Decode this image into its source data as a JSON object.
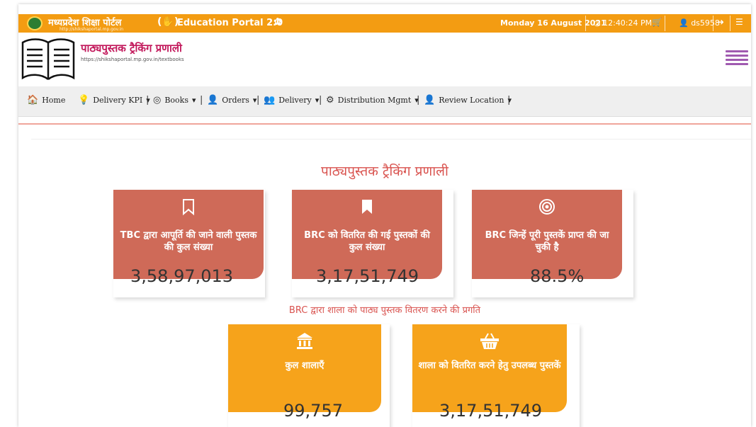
{
  "topbar": {
    "site_name": "मध्यप्रदेश शिक्षा पोर्टल",
    "site_url": "http://shikshaportal.mp.gov.in",
    "portal_name": "Education Portal 2.0",
    "date": "Monday 16 August 2021",
    "time": "12:40:24 PM",
    "user": "ds5958"
  },
  "header": {
    "app_title": "पाठ्यपुस्तक ट्रैकिंग प्रणाली",
    "app_url": "https://shikshaportal.mp.gov.in/textbooks"
  },
  "nav": {
    "home": "Home",
    "delivery_kpi": "Delivery KPI",
    "books": "Books",
    "orders": "Orders",
    "delivery": "Delivery",
    "distribution": "Distribution Mgmt",
    "review_location": "Review Location",
    "caret": "▾",
    "separator": "|"
  },
  "main": {
    "title": "पाठ्यपुस्तक ट्रैकिंग प्रणाली",
    "section2_title": "BRC द्वारा शाला को पाठ्य पुस्तक वितरण करने की प्रगति"
  },
  "cards_top": [
    {
      "icon": "bookmark-outline-icon",
      "label": "TBC द्वारा आपूर्ति की जाने वाली पुस्तक की कुल संख्या",
      "value": "3,58,97,013",
      "color": "#cf6a58"
    },
    {
      "icon": "bookmark-filled-icon",
      "label": "BRC को वितरित की गई पुस्तकों की कुल संख्या",
      "value": "3,17,51,749",
      "color": "#cf6a58"
    },
    {
      "icon": "target-icon",
      "label": "BRC जिन्हें पूरी पुस्तकें प्राप्त की जा चुकी है",
      "value": "88.5%",
      "color": "#cf6a58"
    }
  ],
  "cards_bottom": [
    {
      "icon": "bank-icon",
      "label": "कुल शालाएँ",
      "value": "99,757",
      "color": "#f6a31b"
    },
    {
      "icon": "basket-icon",
      "label": "शाला को वितरित करने हेतु उपलब्ध पुस्तकें",
      "value": "3,17,51,749",
      "color": "#f6a31b"
    }
  ]
}
